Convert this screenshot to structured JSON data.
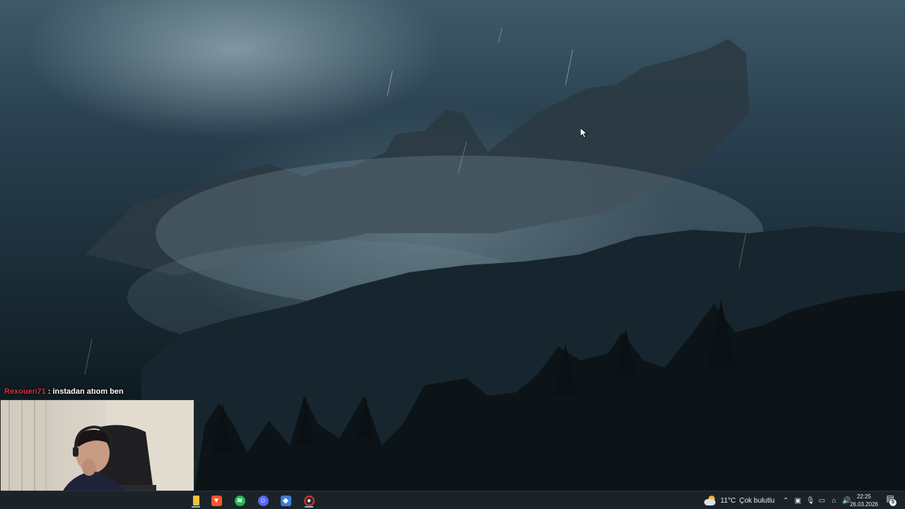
{
  "chat": {
    "username": "Rexouen71",
    "separator": " : ",
    "message": "instadan atıom ben"
  },
  "webcam": {
    "name": "streamer-webcam"
  },
  "taskbar": {
    "pinned_apps": [
      {
        "name": "file-explorer",
        "icon": "folder-icon",
        "color": "#f3c13a"
      },
      {
        "name": "brave-browser",
        "icon": "brave-lion-icon",
        "color": "#fb542b"
      },
      {
        "name": "spotify",
        "icon": "spotify-icon",
        "color": "#1db954"
      },
      {
        "name": "discord",
        "icon": "discord-icon",
        "color": "#5865f2"
      },
      {
        "name": "app-blue",
        "icon": "app-diamond-icon",
        "color": "#3b7fd4"
      },
      {
        "name": "obs-studio",
        "icon": "obs-icon",
        "color": "#e0303a"
      }
    ],
    "weather": {
      "temperature": "11°C",
      "condition": "Çok bulutlu",
      "icon": "cloudy-icon"
    },
    "tray_icons": [
      "chevron-up-icon",
      "network-icon",
      "microphone-icon",
      "display-icon",
      "wifi-icon",
      "speaker-icon"
    ],
    "clock": {
      "time": "22:25",
      "date": "26.03.2026"
    },
    "notifications": {
      "count": "5"
    }
  },
  "colors": {
    "taskbar_bg": "#1c2328",
    "chat_username": "#e0303a"
  }
}
